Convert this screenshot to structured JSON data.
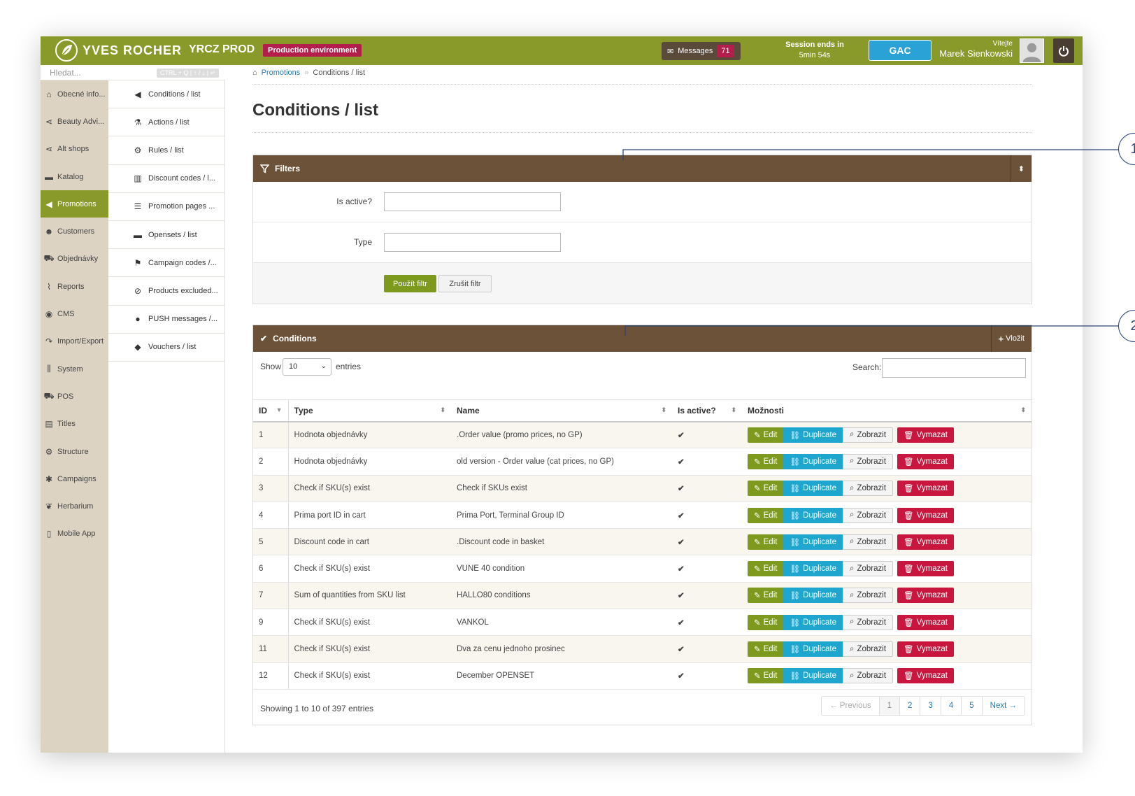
{
  "topbar": {
    "brand": "YVES ROCHER",
    "brand_sub": "YRCZ PROD",
    "env_badge": "Production environment",
    "messages_label": "Messages",
    "messages_count": "71",
    "session_label": "Session ends in",
    "session_time": "5min 54s",
    "gac_label": "GAC",
    "welcome": "Vítejte",
    "user_name": "Marek Sienkowski"
  },
  "search": {
    "placeholder": "Hledat...",
    "shortcut": "CTRL + Q | ↑ / ↓ | ↵"
  },
  "sidebar": {
    "items": [
      {
        "label": "Obecné info...",
        "icon": "home-icon"
      },
      {
        "label": "Beauty Advi...",
        "icon": "share-icon"
      },
      {
        "label": "Alt shops",
        "icon": "share-icon"
      },
      {
        "label": "Katalog",
        "icon": "folder-icon"
      },
      {
        "label": "Promotions",
        "icon": "bullhorn-icon"
      },
      {
        "label": "Customers",
        "icon": "users-icon"
      },
      {
        "label": "Objednávky",
        "icon": "cart-icon"
      },
      {
        "label": "Reports",
        "icon": "chart-icon"
      },
      {
        "label": "CMS",
        "icon": "globe-icon"
      },
      {
        "label": "Import/Export",
        "icon": "share-arrow-icon"
      },
      {
        "label": "System",
        "icon": "sliders-icon"
      },
      {
        "label": "POS",
        "icon": "cart-icon"
      },
      {
        "label": "Titles",
        "icon": "list-box-icon"
      },
      {
        "label": "Structure",
        "icon": "cog-icon"
      },
      {
        "label": "Campaigns",
        "icon": "asterisk-icon"
      },
      {
        "label": "Herbarium",
        "icon": "leaf-icon"
      },
      {
        "label": "Mobile App",
        "icon": "mobile-icon"
      }
    ]
  },
  "submenu": {
    "items": [
      {
        "label": "Conditions / list",
        "icon": "bullhorn-icon"
      },
      {
        "label": "Actions / list",
        "icon": "flask-icon"
      },
      {
        "label": "Rules / list",
        "icon": "cogs-icon"
      },
      {
        "label": "Discount codes / l...",
        "icon": "barcode-icon"
      },
      {
        "label": "Promotion pages ...",
        "icon": "list-icon"
      },
      {
        "label": "Opensets / list",
        "icon": "folder-icon"
      },
      {
        "label": "Campaign codes /...",
        "icon": "flag-icon"
      },
      {
        "label": "Products excluded...",
        "icon": "ban-icon"
      },
      {
        "label": "PUSH messages /...",
        "icon": "comment-icon"
      },
      {
        "label": "Vouchers / list",
        "icon": "tag-icon"
      }
    ]
  },
  "breadcrumb": {
    "parent": "Promotions",
    "sep": "»",
    "current": "Conditions / list"
  },
  "page_title": "Conditions / list",
  "filters": {
    "title": "Filters",
    "fields": [
      {
        "label": "Is active?",
        "value": ""
      },
      {
        "label": "Type",
        "value": ""
      }
    ],
    "apply": "Použít filtr",
    "reset": "Zrušit filtr"
  },
  "conditions": {
    "title": "Conditions",
    "insert": "Vložit",
    "show_label": "Show",
    "show_value": "10",
    "entries_label": "entries",
    "search_label": "Search:",
    "columns": [
      "ID",
      "Type",
      "Name",
      "Is active?",
      "Možnosti"
    ],
    "rows": [
      {
        "id": "1",
        "type": "Hodnota objednávky",
        "name": ".Order value (promo prices, no GP)",
        "active": "✔"
      },
      {
        "id": "2",
        "type": "Hodnota objednávky",
        "name": "old version - Order value (cat prices, no GP)",
        "active": "✔"
      },
      {
        "id": "3",
        "type": "Check if SKU(s) exist",
        "name": "Check if SKUs exist",
        "active": "✔"
      },
      {
        "id": "4",
        "type": "Prima port ID in cart",
        "name": "Prima Port, Terminal Group ID",
        "active": "✔"
      },
      {
        "id": "5",
        "type": "Discount code in cart",
        "name": ".Discount code in basket",
        "active": "✔"
      },
      {
        "id": "6",
        "type": "Check if SKU(s) exist",
        "name": "VUNE 40 condition",
        "active": "✔"
      },
      {
        "id": "7",
        "type": "Sum of quantities from SKU list",
        "name": "HALLO80 conditions",
        "active": "✔"
      },
      {
        "id": "9",
        "type": "Check if SKU(s) exist",
        "name": "VANKOL",
        "active": "✔"
      },
      {
        "id": "11",
        "type": "Check if SKU(s) exist",
        "name": "Dva za cenu jednoho prosinec",
        "active": "✔"
      },
      {
        "id": "12",
        "type": "Check if SKU(s) exist",
        "name": "December OPENSET",
        "active": "✔"
      }
    ],
    "actions": {
      "edit": "Edit",
      "duplicate": "Duplicate",
      "view": "Zobrazit",
      "delete": "Vymazat"
    },
    "showing": "Showing 1 to 10 of 397 entries",
    "pager": {
      "prev": "← Previous",
      "pages": [
        "1",
        "2",
        "3",
        "4",
        "5"
      ],
      "next": "Next →"
    }
  },
  "callouts": [
    "1",
    "2"
  ],
  "colors": {
    "topbar": "#8a9a2a",
    "box_header": "#6b5238",
    "edit": "#7d9a1e",
    "duplicate": "#1fa6cf",
    "delete": "#c8163e",
    "badge": "#b41e4a"
  }
}
